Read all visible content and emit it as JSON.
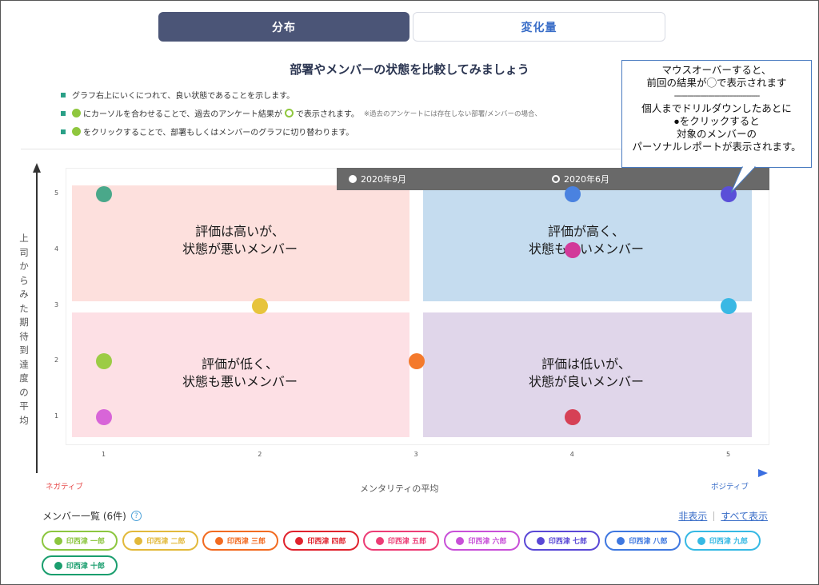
{
  "tabs": [
    {
      "label": "分布",
      "active": true
    },
    {
      "label": "変化量",
      "active": false
    }
  ],
  "heading": "部署やメンバーの状態を比較してみましょう",
  "notes": {
    "n1": "グラフ右上にいくにつれて、良い状態であることを示します。",
    "n2a": "にカーソルを合わせることで、過去のアンケート結果が",
    "n2b": "で表示されます。",
    "n2c": "※過去のアンケートには存在しない部署/メンバーの場合、",
    "n3": "をクリックすることで、部署もしくはメンバーのグラフに切り替わります。"
  },
  "callout": {
    "l1": "マウスオーバーすると、",
    "l2": "前回の結果が◯で表示されます",
    "dash": "----------------------------------------",
    "l3": "個人までドリルダウンしたあとに",
    "l4": "●をクリックすると",
    "l5": "対象のメンバーの",
    "l6": "パーソナルレポートが表示されます。"
  },
  "quadrants": {
    "top_left": {
      "l1": "評価は高いが、",
      "l2": "状態が悪いメンバー"
    },
    "top_right": {
      "l1": "評価が高く、",
      "l2": "状態も良いメンバー"
    },
    "bottom_left": {
      "l1": "評価が低く、",
      "l2": "状態も悪いメンバー"
    },
    "bottom_right": {
      "l1": "評価は低いが、",
      "l2": "状態が良いメンバー"
    }
  },
  "axis": {
    "ylabel": "上司からみた期待到達度の平均",
    "xlabel": "メンタリティの平均",
    "negative": "ネガティブ",
    "positive": "ポジティブ"
  },
  "chart_data": {
    "type": "scatter",
    "xlabel": "メンタリティの平均",
    "ylabel": "上司からみた期待到達度の平均",
    "xlim": [
      1,
      5
    ],
    "ylim": [
      1,
      5
    ],
    "xticks": [
      "1",
      "2",
      "3",
      "4",
      "5"
    ],
    "yticks": [
      "1",
      "2",
      "3",
      "4",
      "5"
    ],
    "legend": [
      "2020年9月",
      "2020年6月"
    ],
    "legend_position": "top",
    "points": [
      {
        "x": 1,
        "y": 5,
        "color": "#4aa88a"
      },
      {
        "x": 1,
        "y": 2,
        "color": "#9ccc45"
      },
      {
        "x": 1,
        "y": 1,
        "color": "#d865d8"
      },
      {
        "x": 2,
        "y": 3,
        "color": "#e7c43c"
      },
      {
        "x": 3,
        "y": 2,
        "color": "#f47a2c"
      },
      {
        "x": 4,
        "y": 5,
        "color": "#4a82e0"
      },
      {
        "x": 4,
        "y": 4,
        "color": "#d23a9a"
      },
      {
        "x": 4,
        "y": 1,
        "color": "#d64055"
      },
      {
        "x": 5,
        "y": 5,
        "color": "#5a4fd8"
      },
      {
        "x": 5,
        "y": 3,
        "color": "#3ab8e4"
      }
    ]
  },
  "members": {
    "title": "メンバー一覧 (6件)",
    "help": "?",
    "hide": "非表示",
    "show_all": "すべて表示",
    "items": [
      {
        "name": "印西津 一郎",
        "color": "#8cc63f"
      },
      {
        "name": "印西津 二郎",
        "color": "#e2b93b"
      },
      {
        "name": "印西津 三郎",
        "color": "#f26b21"
      },
      {
        "name": "印西津 四郎",
        "color": "#e0222d"
      },
      {
        "name": "印西津 五郎",
        "color": "#ec3d76"
      },
      {
        "name": "印西津 六郎",
        "color": "#c850d8"
      },
      {
        "name": "印西津 七郎",
        "color": "#5a48d6"
      },
      {
        "name": "印西津 八郎",
        "color": "#3f78e0"
      },
      {
        "name": "印西津 九郎",
        "color": "#36b9e4"
      },
      {
        "name": "印西津 十郎",
        "color": "#1a9e6e"
      }
    ]
  }
}
